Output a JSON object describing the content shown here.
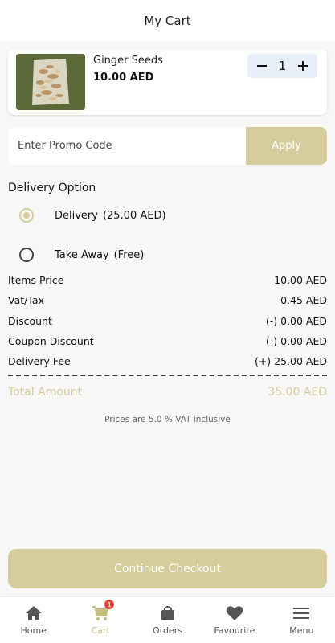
{
  "header": {
    "title": "My Cart"
  },
  "cart": {
    "items": [
      {
        "name": "Ginger Seeds",
        "price": "10.00 AED",
        "quantity": "1"
      }
    ]
  },
  "promo": {
    "placeholder": "Enter Promo Code",
    "apply_label": "Apply"
  },
  "delivery": {
    "title": "Delivery Option",
    "options": [
      {
        "label": "Delivery",
        "price": "(25.00 AED)",
        "selected": true
      },
      {
        "label": "Take Away",
        "price": "(Free)",
        "selected": false
      }
    ]
  },
  "summary": {
    "rows": [
      {
        "label": "Items Price",
        "value": "10.00 AED"
      },
      {
        "label": "Vat/Tax",
        "value": "0.45 AED"
      },
      {
        "label": "Discount",
        "value": "(-) 0.00 AED"
      },
      {
        "label": "Coupon Discount",
        "value": "(-) 0.00 AED"
      },
      {
        "label": "Delivery Fee",
        "value": "(+) 25.00 AED"
      }
    ],
    "total_label": "Total Amount",
    "total_value": "35.00 AED",
    "vat_note": "Prices are 5.0 % VAT inclusive"
  },
  "checkout_label": "Continue Checkout",
  "tabs": [
    {
      "label": "Home",
      "icon": "home-icon",
      "active": false
    },
    {
      "label": "Cart",
      "icon": "cart-icon",
      "active": true,
      "badge": "1"
    },
    {
      "label": "Orders",
      "icon": "shopping-bag-icon",
      "active": false
    },
    {
      "label": "Favourite",
      "icon": "heart-icon",
      "active": false
    },
    {
      "label": "Menu",
      "icon": "menu-icon",
      "active": false
    }
  ],
  "colors": {
    "accent": "#d6cc9c",
    "active_tab": "#c9bc82",
    "badge": "#d9453a",
    "stepper_bg": "#e8eff8"
  }
}
